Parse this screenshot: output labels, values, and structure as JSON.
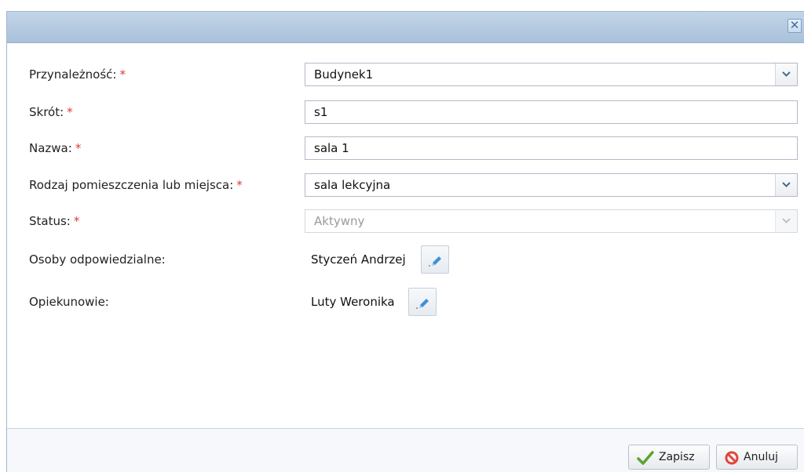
{
  "dialog": {
    "close_glyph": "✕"
  },
  "form": {
    "required_marker": "*",
    "membership": {
      "label": "Przynależność:",
      "value": "Budynek1"
    },
    "abbreviation": {
      "label": "Skrót:",
      "value": "s1"
    },
    "name": {
      "label": "Nazwa:",
      "value": "sala 1"
    },
    "room_type": {
      "label": "Rodzaj pomieszczenia lub miejsca:",
      "value": "sala lekcyjna"
    },
    "status": {
      "label": "Status:",
      "value": "Aktywny",
      "disabled": true
    },
    "responsible": {
      "label": "Osoby odpowiedzialne:",
      "value": "Styczeń Andrzej",
      "edit_icon": "pencil-icon"
    },
    "guardians": {
      "label": "Opiekunowie:",
      "value": "Luty Weronika",
      "edit_icon": "pencil-icon"
    }
  },
  "footer": {
    "save_label": "Zapisz",
    "save_icon": "check-icon",
    "cancel_label": "Anuluj",
    "cancel_icon": "cancel-icon"
  },
  "colors": {
    "titlebar": "#b4c9df",
    "required": "#e0393a",
    "check": "#5aa52f",
    "cancel": "#e0473a"
  }
}
